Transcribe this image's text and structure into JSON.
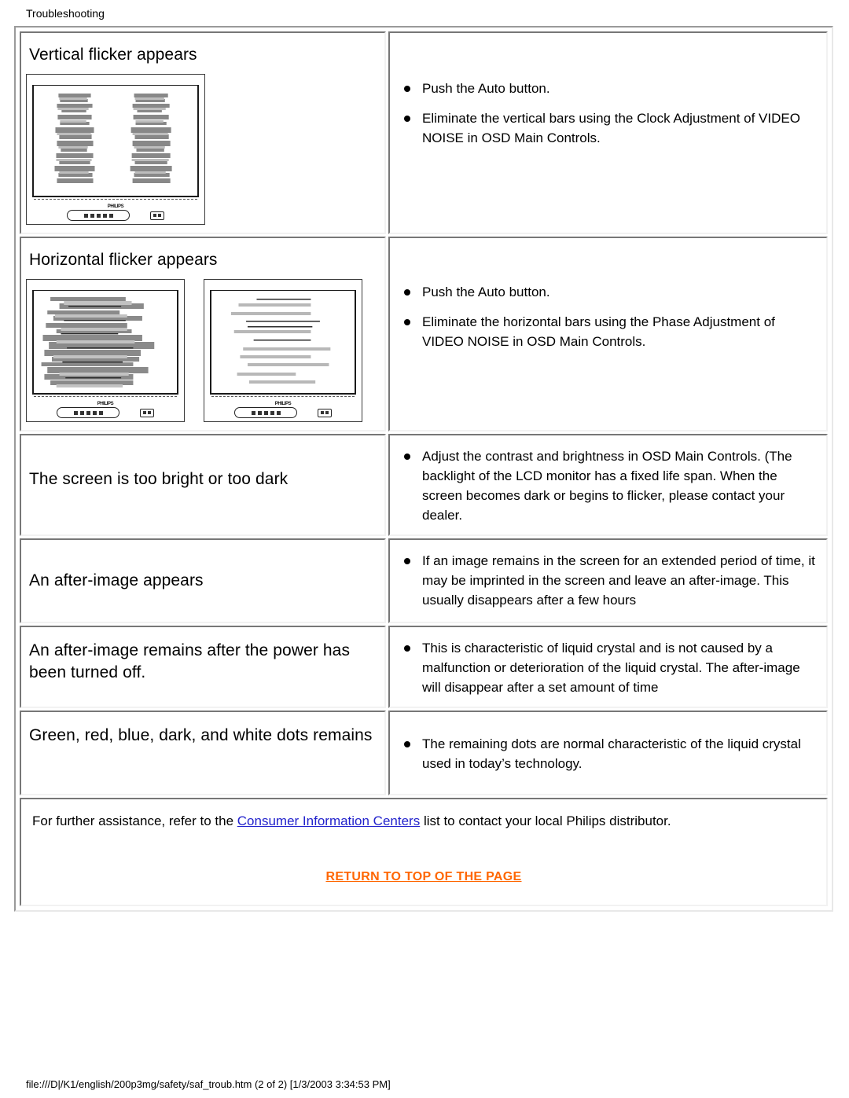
{
  "page": {
    "title": "Troubleshooting",
    "footer_path": "file:///D|/K1/english/200p3mg/safety/saf_troub.htm (2 of 2) [1/3/2003 3:34:53 PM]"
  },
  "colors": {
    "link": "#2222cc",
    "return_link": "#ff6600",
    "text": "#000000",
    "cell_border_dark": "#777777",
    "cell_border_light": "#f2f2f2"
  },
  "rows": [
    {
      "symptom": "Vertical flicker appears",
      "illustration": "monitor-vertical-flicker",
      "monitors": 1,
      "bullets": [
        "Push the Auto button.",
        "Eliminate the vertical bars using the Clock Adjustment of VIDEO NOISE in OSD Main Controls."
      ]
    },
    {
      "symptom": "Horizontal flicker appears",
      "illustration": "monitor-horizontal-flicker",
      "monitors": 2,
      "bullets": [
        "Push the Auto button.",
        "Eliminate the horizontal bars using the Phase Adjustment of VIDEO NOISE in OSD Main Controls."
      ]
    },
    {
      "symptom": "The screen is too bright or too dark",
      "illustration": null,
      "monitors": 0,
      "bullets": [
        "Adjust the contrast and brightness in OSD Main Controls. (The backlight of the LCD monitor has a fixed life span. When the screen becomes dark or begins to flicker, please contact your dealer."
      ]
    },
    {
      "symptom": "An after-image appears",
      "illustration": null,
      "monitors": 0,
      "bullets": [
        "If an image remains in the screen for an extended period of time, it may be imprinted in the screen and leave an after-image. This usually disappears after a few hours"
      ]
    },
    {
      "symptom": "An after-image remains after the power has been turned off.",
      "illustration": null,
      "monitors": 0,
      "bullets": [
        "This is characteristic of liquid crystal and is not caused by a malfunction or deterioration of the liquid crystal. The after-image will disappear after a set amount of time"
      ]
    },
    {
      "symptom": "Green, red, blue, dark, and white dots remains",
      "illustration": null,
      "monitors": 0,
      "bullets": [
        "The remaining dots are normal characteristic of the liquid crystal used in today’s technology."
      ]
    }
  ],
  "assistance": {
    "before_link": "For further assistance, refer to the ",
    "link_text": "Consumer Information Centers",
    "after_link": " list to contact your local Philips distributor."
  },
  "return_to_top": {
    "label": "RETURN TO TOP OF THE PAGE"
  },
  "monitor_graphic": {
    "brand": "PHILIPS"
  }
}
